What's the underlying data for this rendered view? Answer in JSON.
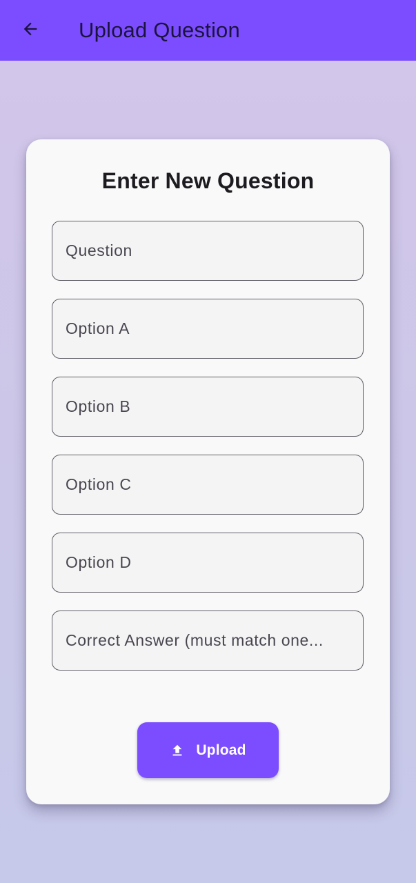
{
  "app_bar": {
    "title": "Upload Question",
    "back_icon": "arrow-back-icon",
    "background": "#7c4dff"
  },
  "form": {
    "heading": "Enter New Question",
    "fields": [
      {
        "placeholder": "Question"
      },
      {
        "placeholder": "Option A"
      },
      {
        "placeholder": "Option B"
      },
      {
        "placeholder": "Option C"
      },
      {
        "placeholder": "Option D"
      },
      {
        "placeholder": "Correct Answer (must match one..."
      }
    ],
    "upload_button": {
      "label": "Upload",
      "icon": "upload-icon",
      "color": "#7c4dff"
    }
  }
}
